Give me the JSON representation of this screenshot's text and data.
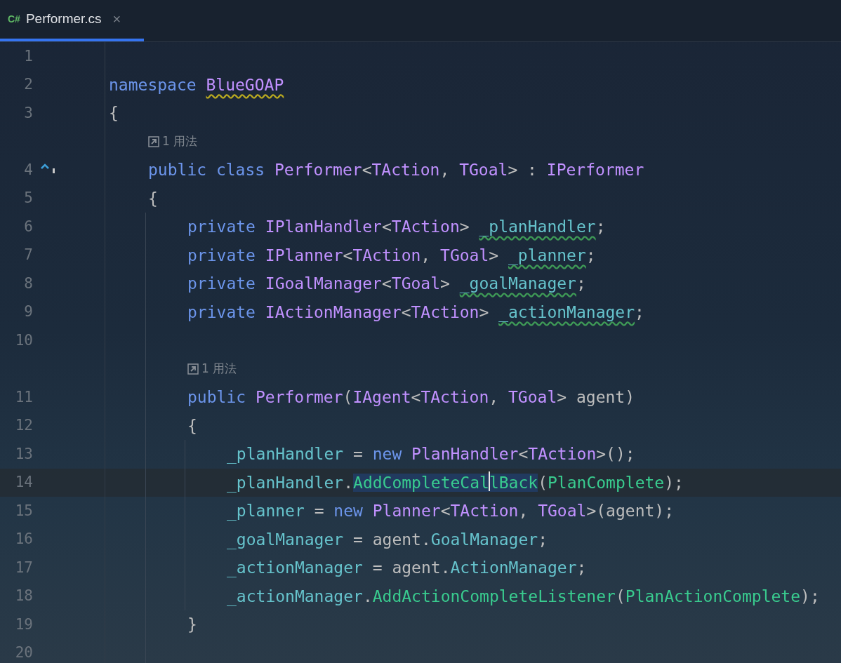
{
  "tab": {
    "icon_text": "C#",
    "label": "Performer.cs",
    "close": "×",
    "selected": true
  },
  "lines": [
    {
      "number": "1"
    },
    {
      "number": "2",
      "tokens": [
        {
          "text": "namespace ",
          "kind": "keyword"
        },
        {
          "text": "BlueGOAP",
          "kind": "type",
          "warning": true
        }
      ]
    },
    {
      "number": "3",
      "tokens": [
        {
          "text": "{",
          "kind": "plain"
        }
      ],
      "children": [
        {
          "number": "4",
          "hint": "1 用法",
          "implements_marker": true,
          "tokens": [
            {
              "text": "public class ",
              "kind": "keyword"
            },
            {
              "text": "Performer",
              "kind": "type"
            },
            {
              "text": "<",
              "kind": "plain"
            },
            {
              "text": "TAction",
              "kind": "type"
            },
            {
              "text": ", ",
              "kind": "plain"
            },
            {
              "text": "TGoal",
              "kind": "type"
            },
            {
              "text": "> : ",
              "kind": "plain"
            },
            {
              "text": "IPerformer",
              "kind": "type"
            }
          ]
        },
        {
          "number": "5",
          "tokens": [
            {
              "text": "{",
              "kind": "plain"
            }
          ],
          "children": [
            {
              "number": "6",
              "tokens": [
                {
                  "text": "private ",
                  "kind": "keyword"
                },
                {
                  "text": "IPlanHandler",
                  "kind": "type"
                },
                {
                  "text": "<",
                  "kind": "plain"
                },
                {
                  "text": "TAction",
                  "kind": "type"
                },
                {
                  "text": "> ",
                  "kind": "plain"
                },
                {
                  "text": "_planHandler",
                  "kind": "field",
                  "unused": true
                },
                {
                  "text": ";",
                  "kind": "plain"
                }
              ]
            },
            {
              "number": "7",
              "tokens": [
                {
                  "text": "private ",
                  "kind": "keyword"
                },
                {
                  "text": "IPlanner",
                  "kind": "type"
                },
                {
                  "text": "<",
                  "kind": "plain"
                },
                {
                  "text": "TAction",
                  "kind": "type"
                },
                {
                  "text": ", ",
                  "kind": "plain"
                },
                {
                  "text": "TGoal",
                  "kind": "type"
                },
                {
                  "text": "> ",
                  "kind": "plain"
                },
                {
                  "text": "_planner",
                  "kind": "field",
                  "unused": true
                },
                {
                  "text": ";",
                  "kind": "plain"
                }
              ]
            },
            {
              "number": "8",
              "tokens": [
                {
                  "text": "private ",
                  "kind": "keyword"
                },
                {
                  "text": "IGoalManager",
                  "kind": "type"
                },
                {
                  "text": "<",
                  "kind": "plain"
                },
                {
                  "text": "TGoal",
                  "kind": "type"
                },
                {
                  "text": "> ",
                  "kind": "plain"
                },
                {
                  "text": "_goalManager",
                  "kind": "field",
                  "unused": true
                },
                {
                  "text": ";",
                  "kind": "plain"
                }
              ]
            },
            {
              "number": "9",
              "tokens": [
                {
                  "text": "private ",
                  "kind": "keyword"
                },
                {
                  "text": "IActionManager",
                  "kind": "type"
                },
                {
                  "text": "<",
                  "kind": "plain"
                },
                {
                  "text": "TAction",
                  "kind": "type"
                },
                {
                  "text": "> ",
                  "kind": "plain"
                },
                {
                  "text": "_actionManager",
                  "kind": "field",
                  "unused": true
                },
                {
                  "text": ";",
                  "kind": "plain"
                }
              ]
            },
            {
              "number": "10"
            },
            {
              "number": "11",
              "hint": "1 用法",
              "tokens": [
                {
                  "text": "public ",
                  "kind": "keyword"
                },
                {
                  "text": "Performer",
                  "kind": "type"
                },
                {
                  "text": "(",
                  "kind": "plain"
                },
                {
                  "text": "IAgent",
                  "kind": "type"
                },
                {
                  "text": "<",
                  "kind": "plain"
                },
                {
                  "text": "TAction",
                  "kind": "type"
                },
                {
                  "text": ", ",
                  "kind": "plain"
                },
                {
                  "text": "TGoal",
                  "kind": "type"
                },
                {
                  "text": "> agent)",
                  "kind": "plain"
                }
              ]
            },
            {
              "number": "12",
              "tokens": [
                {
                  "text": "{",
                  "kind": "plain"
                }
              ],
              "children": [
                {
                  "number": "13",
                  "tokens": [
                    {
                      "text": "_planHandler",
                      "kind": "field"
                    },
                    {
                      "text": " = ",
                      "kind": "plain"
                    },
                    {
                      "text": "new ",
                      "kind": "keyword"
                    },
                    {
                      "text": "PlanHandler",
                      "kind": "type"
                    },
                    {
                      "text": "<",
                      "kind": "plain"
                    },
                    {
                      "text": "TAction",
                      "kind": "type"
                    },
                    {
                      "text": ">();",
                      "kind": "plain"
                    }
                  ]
                },
                {
                  "number": "14",
                  "current": true,
                  "tokens": [
                    {
                      "text": "_planHandler",
                      "kind": "field",
                      "selected": false
                    },
                    {
                      "text": ".",
                      "kind": "plain",
                      "selected": false
                    },
                    {
                      "text": "AddCompleteCal",
                      "kind": "method",
                      "selected": true
                    },
                    {
                      "text": "lBack",
                      "kind": "method",
                      "selected": true,
                      "caret_before": true
                    },
                    {
                      "text": "(",
                      "kind": "plain",
                      "selected": false
                    },
                    {
                      "text": "PlanComplete",
                      "kind": "method",
                      "selected": false
                    },
                    {
                      "text": ");",
                      "kind": "plain",
                      "selected": false
                    }
                  ]
                },
                {
                  "number": "15",
                  "tokens": [
                    {
                      "text": "_planner",
                      "kind": "field"
                    },
                    {
                      "text": " = ",
                      "kind": "plain"
                    },
                    {
                      "text": "new ",
                      "kind": "keyword"
                    },
                    {
                      "text": "Planner",
                      "kind": "type"
                    },
                    {
                      "text": "<",
                      "kind": "plain"
                    },
                    {
                      "text": "TAction",
                      "kind": "type"
                    },
                    {
                      "text": ", ",
                      "kind": "plain"
                    },
                    {
                      "text": "TGoal",
                      "kind": "type"
                    },
                    {
                      "text": ">(agent);",
                      "kind": "plain"
                    }
                  ]
                },
                {
                  "number": "16",
                  "tokens": [
                    {
                      "text": "_goalManager",
                      "kind": "field"
                    },
                    {
                      "text": " = agent.",
                      "kind": "plain"
                    },
                    {
                      "text": "GoalManager",
                      "kind": "property"
                    },
                    {
                      "text": ";",
                      "kind": "plain"
                    }
                  ]
                },
                {
                  "number": "17",
                  "tokens": [
                    {
                      "text": "_actionManager",
                      "kind": "field"
                    },
                    {
                      "text": " = agent.",
                      "kind": "plain"
                    },
                    {
                      "text": "ActionManager",
                      "kind": "property"
                    },
                    {
                      "text": ";",
                      "kind": "plain"
                    }
                  ]
                },
                {
                  "number": "18",
                  "tokens": [
                    {
                      "text": "_actionManager",
                      "kind": "field"
                    },
                    {
                      "text": ".",
                      "kind": "plain"
                    },
                    {
                      "text": "AddActionCompleteListener",
                      "kind": "method"
                    },
                    {
                      "text": "(",
                      "kind": "plain"
                    },
                    {
                      "text": "PlanActionComplete",
                      "kind": "method"
                    },
                    {
                      "text": ");",
                      "kind": "plain"
                    }
                  ]
                }
              ]
            },
            {
              "number": "19",
              "tokens": [
                {
                  "text": "}",
                  "kind": "plain"
                }
              ]
            },
            {
              "number": "20"
            }
          ]
        }
      ]
    }
  ]
}
